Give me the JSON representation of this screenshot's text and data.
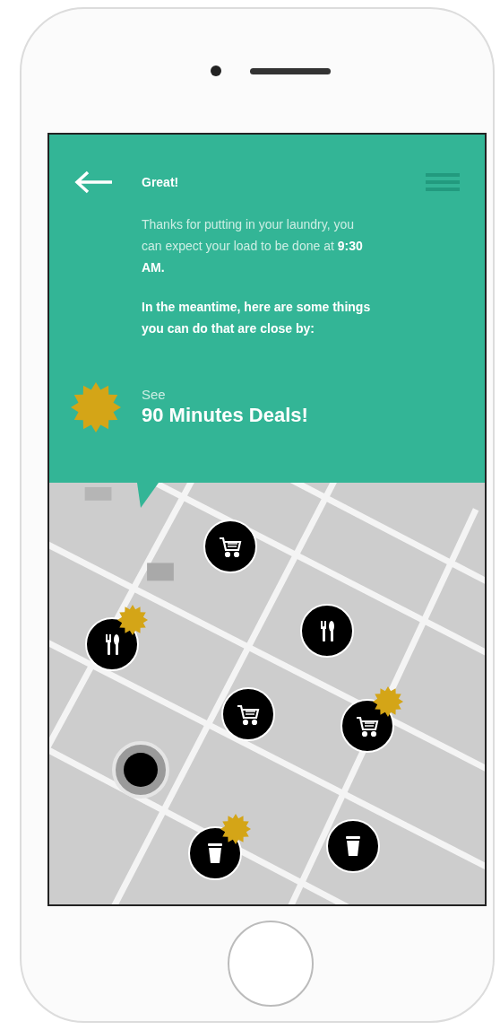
{
  "header": {
    "title": "Great!",
    "message": "Thanks for putting in your laundry, you can expect your load to be done at **9:30 AM.**",
    "prompt": "In the meantime, here are some things you can do that are close by:",
    "deal_kicker": "See",
    "deal_title": "90 Minutes Deals!"
  },
  "map": {
    "pins": [
      {
        "kind": "cart",
        "deal": false
      },
      {
        "kind": "food",
        "deal": true
      },
      {
        "kind": "food",
        "deal": false
      },
      {
        "kind": "cart",
        "deal": false
      },
      {
        "kind": "cart",
        "deal": true
      },
      {
        "kind": "cup",
        "deal": true
      },
      {
        "kind": "cup",
        "deal": false
      }
    ]
  }
}
